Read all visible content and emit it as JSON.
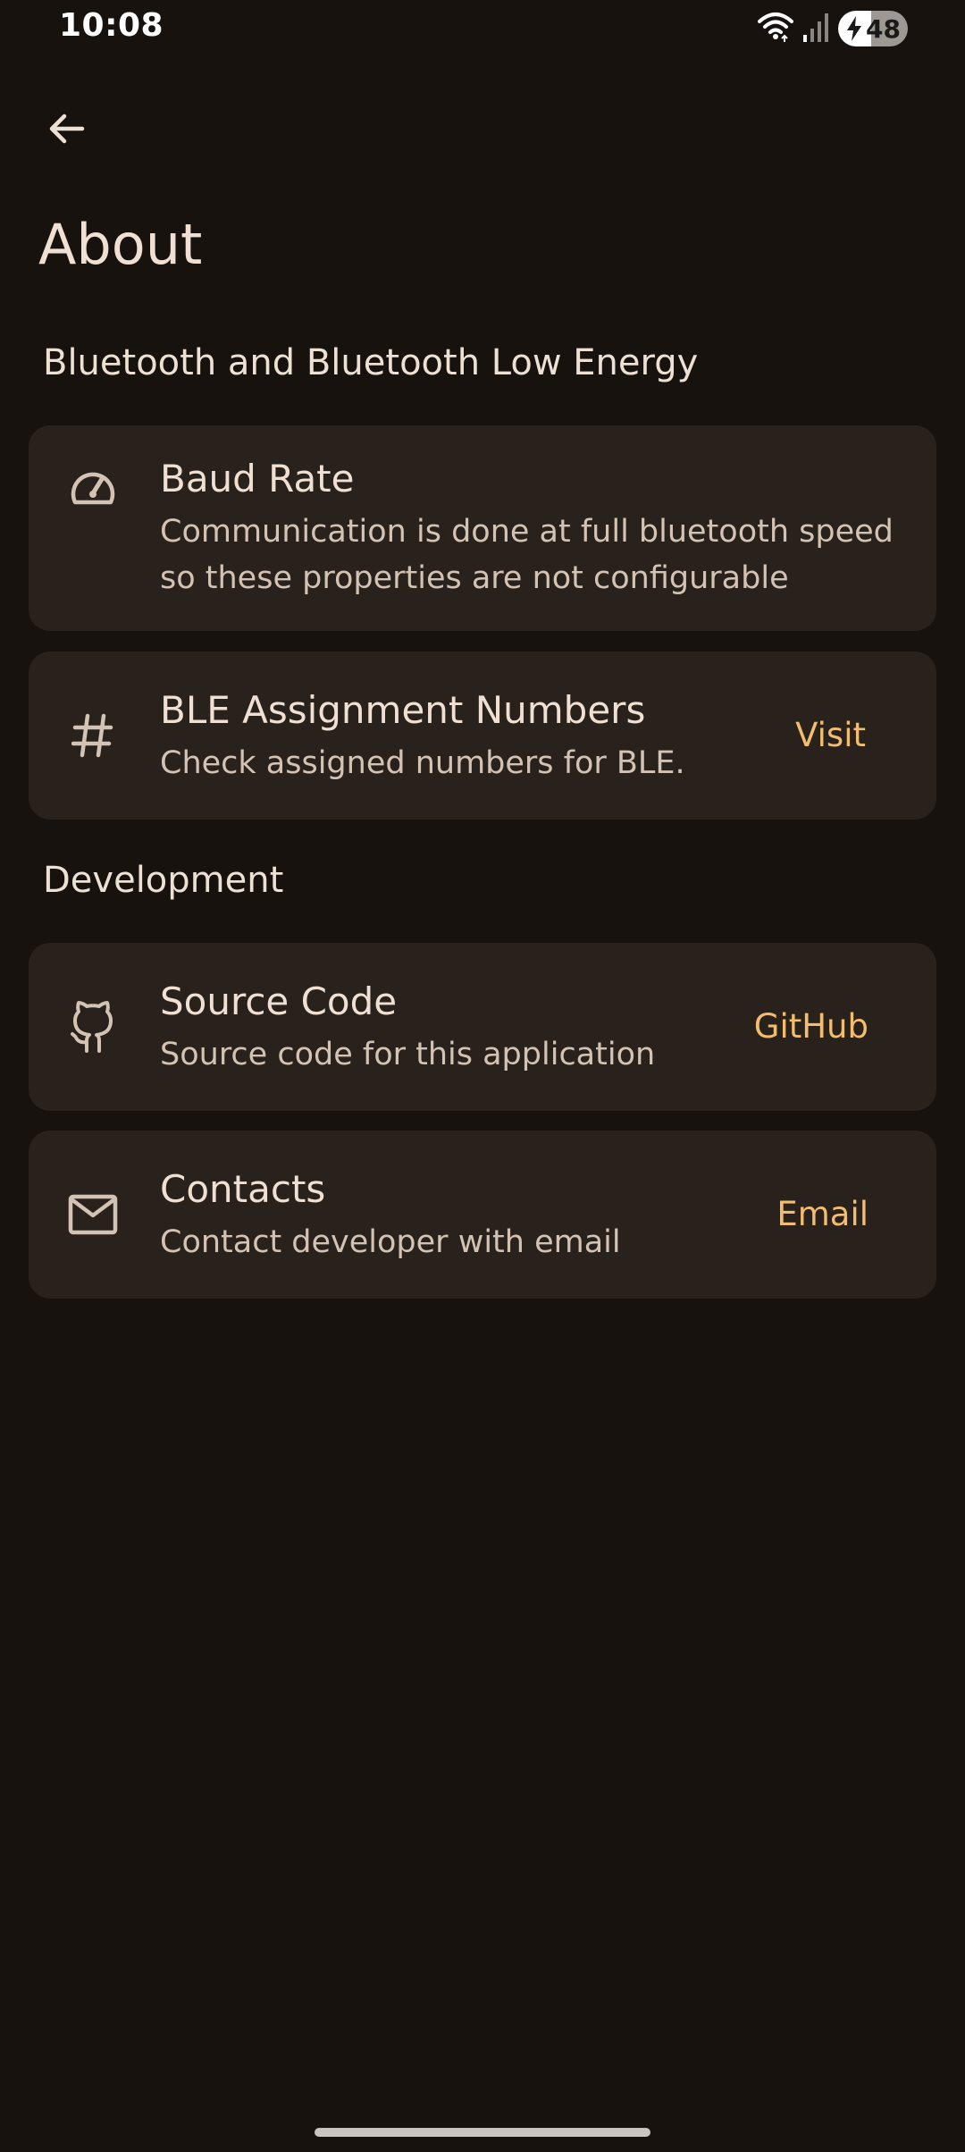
{
  "status_bar": {
    "time": "10:08",
    "battery_level": "48",
    "battery_fraction": 0.48,
    "icons": [
      "wifi-icon",
      "cellular-signal-icon",
      "battery-charging-icon"
    ]
  },
  "app_bar": {
    "back_icon": "arrow-left-icon",
    "title": "About"
  },
  "sections": [
    {
      "header": "Bluetooth and Bluetooth Low Energy",
      "items": [
        {
          "icon": "speedometer-icon",
          "title": "Baud Rate",
          "description": "Communication is done at full bluetooth speed so these properties are not configurable",
          "action": ""
        },
        {
          "icon": "hash-icon",
          "title": "BLE Assignment Numbers",
          "description": "Check assigned numbers for BLE.",
          "action": "Visit"
        }
      ]
    },
    {
      "header": "Development",
      "items": [
        {
          "icon": "github-icon",
          "title": "Source Code",
          "description": "Source code for this application",
          "action": "GitHub"
        },
        {
          "icon": "mail-icon",
          "title": "Contacts",
          "description": "Contact developer with email",
          "action": "Email"
        }
      ]
    }
  ],
  "colors": {
    "background": "#17120e",
    "card": "#29211b",
    "accent": "#f2bd6f",
    "text_primary": "#efe0d3",
    "text_secondary": "#d3c3b5"
  }
}
